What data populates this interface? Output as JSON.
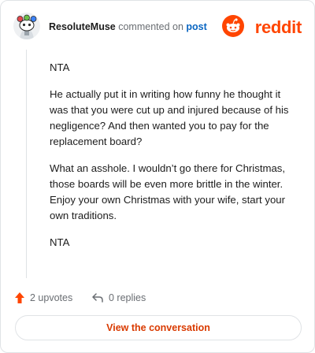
{
  "header": {
    "username": "ResoluteMuse",
    "action_text": "commented on",
    "post_link": "post",
    "brand": "reddit"
  },
  "comment": {
    "paragraphs": [
      "NTA",
      "He actually put it in writing how funny he thought it was that you were cut up and injured because of his negligence? And then wanted you to pay for the replacement board?",
      "What an asshole. I wouldn’t go there for Christmas, those boards will be even more brittle in the winter. Enjoy your own Christmas with your wife, start your own traditions.",
      "NTA"
    ]
  },
  "actions": {
    "upvotes": "2 upvotes",
    "replies": "0 replies"
  },
  "button": {
    "view_label": "View the conversation"
  },
  "colors": {
    "brand": "#ff4500",
    "link": "#0a66c2",
    "button_text": "#d93a00"
  },
  "icons": {
    "avatar": "snoo-avatar-icon",
    "logo": "reddit-logo-icon",
    "upvote": "upvote-arrow-icon",
    "reply": "reply-arrow-icon"
  }
}
